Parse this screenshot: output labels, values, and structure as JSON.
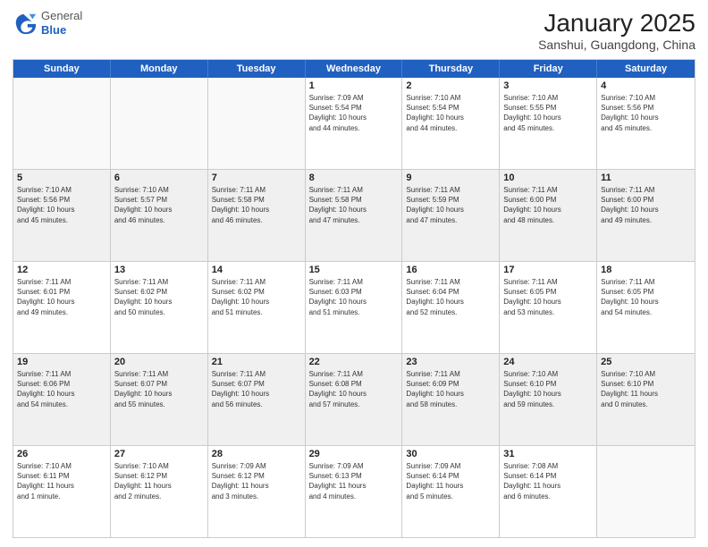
{
  "header": {
    "logo_general": "General",
    "logo_blue": "Blue",
    "month_year": "January 2025",
    "location": "Sanshui, Guangdong, China"
  },
  "days_of_week": [
    "Sunday",
    "Monday",
    "Tuesday",
    "Wednesday",
    "Thursday",
    "Friday",
    "Saturday"
  ],
  "weeks": [
    [
      {
        "day": "",
        "info": ""
      },
      {
        "day": "",
        "info": ""
      },
      {
        "day": "",
        "info": ""
      },
      {
        "day": "1",
        "info": "Sunrise: 7:09 AM\nSunset: 5:54 PM\nDaylight: 10 hours\nand 44 minutes."
      },
      {
        "day": "2",
        "info": "Sunrise: 7:10 AM\nSunset: 5:54 PM\nDaylight: 10 hours\nand 44 minutes."
      },
      {
        "day": "3",
        "info": "Sunrise: 7:10 AM\nSunset: 5:55 PM\nDaylight: 10 hours\nand 45 minutes."
      },
      {
        "day": "4",
        "info": "Sunrise: 7:10 AM\nSunset: 5:56 PM\nDaylight: 10 hours\nand 45 minutes."
      }
    ],
    [
      {
        "day": "5",
        "info": "Sunrise: 7:10 AM\nSunset: 5:56 PM\nDaylight: 10 hours\nand 45 minutes."
      },
      {
        "day": "6",
        "info": "Sunrise: 7:10 AM\nSunset: 5:57 PM\nDaylight: 10 hours\nand 46 minutes."
      },
      {
        "day": "7",
        "info": "Sunrise: 7:11 AM\nSunset: 5:58 PM\nDaylight: 10 hours\nand 46 minutes."
      },
      {
        "day": "8",
        "info": "Sunrise: 7:11 AM\nSunset: 5:58 PM\nDaylight: 10 hours\nand 47 minutes."
      },
      {
        "day": "9",
        "info": "Sunrise: 7:11 AM\nSunset: 5:59 PM\nDaylight: 10 hours\nand 47 minutes."
      },
      {
        "day": "10",
        "info": "Sunrise: 7:11 AM\nSunset: 6:00 PM\nDaylight: 10 hours\nand 48 minutes."
      },
      {
        "day": "11",
        "info": "Sunrise: 7:11 AM\nSunset: 6:00 PM\nDaylight: 10 hours\nand 49 minutes."
      }
    ],
    [
      {
        "day": "12",
        "info": "Sunrise: 7:11 AM\nSunset: 6:01 PM\nDaylight: 10 hours\nand 49 minutes."
      },
      {
        "day": "13",
        "info": "Sunrise: 7:11 AM\nSunset: 6:02 PM\nDaylight: 10 hours\nand 50 minutes."
      },
      {
        "day": "14",
        "info": "Sunrise: 7:11 AM\nSunset: 6:02 PM\nDaylight: 10 hours\nand 51 minutes."
      },
      {
        "day": "15",
        "info": "Sunrise: 7:11 AM\nSunset: 6:03 PM\nDaylight: 10 hours\nand 51 minutes."
      },
      {
        "day": "16",
        "info": "Sunrise: 7:11 AM\nSunset: 6:04 PM\nDaylight: 10 hours\nand 52 minutes."
      },
      {
        "day": "17",
        "info": "Sunrise: 7:11 AM\nSunset: 6:05 PM\nDaylight: 10 hours\nand 53 minutes."
      },
      {
        "day": "18",
        "info": "Sunrise: 7:11 AM\nSunset: 6:05 PM\nDaylight: 10 hours\nand 54 minutes."
      }
    ],
    [
      {
        "day": "19",
        "info": "Sunrise: 7:11 AM\nSunset: 6:06 PM\nDaylight: 10 hours\nand 54 minutes."
      },
      {
        "day": "20",
        "info": "Sunrise: 7:11 AM\nSunset: 6:07 PM\nDaylight: 10 hours\nand 55 minutes."
      },
      {
        "day": "21",
        "info": "Sunrise: 7:11 AM\nSunset: 6:07 PM\nDaylight: 10 hours\nand 56 minutes."
      },
      {
        "day": "22",
        "info": "Sunrise: 7:11 AM\nSunset: 6:08 PM\nDaylight: 10 hours\nand 57 minutes."
      },
      {
        "day": "23",
        "info": "Sunrise: 7:11 AM\nSunset: 6:09 PM\nDaylight: 10 hours\nand 58 minutes."
      },
      {
        "day": "24",
        "info": "Sunrise: 7:10 AM\nSunset: 6:10 PM\nDaylight: 10 hours\nand 59 minutes."
      },
      {
        "day": "25",
        "info": "Sunrise: 7:10 AM\nSunset: 6:10 PM\nDaylight: 11 hours\nand 0 minutes."
      }
    ],
    [
      {
        "day": "26",
        "info": "Sunrise: 7:10 AM\nSunset: 6:11 PM\nDaylight: 11 hours\nand 1 minute."
      },
      {
        "day": "27",
        "info": "Sunrise: 7:10 AM\nSunset: 6:12 PM\nDaylight: 11 hours\nand 2 minutes."
      },
      {
        "day": "28",
        "info": "Sunrise: 7:09 AM\nSunset: 6:12 PM\nDaylight: 11 hours\nand 3 minutes."
      },
      {
        "day": "29",
        "info": "Sunrise: 7:09 AM\nSunset: 6:13 PM\nDaylight: 11 hours\nand 4 minutes."
      },
      {
        "day": "30",
        "info": "Sunrise: 7:09 AM\nSunset: 6:14 PM\nDaylight: 11 hours\nand 5 minutes."
      },
      {
        "day": "31",
        "info": "Sunrise: 7:08 AM\nSunset: 6:14 PM\nDaylight: 11 hours\nand 6 minutes."
      },
      {
        "day": "",
        "info": ""
      }
    ]
  ]
}
